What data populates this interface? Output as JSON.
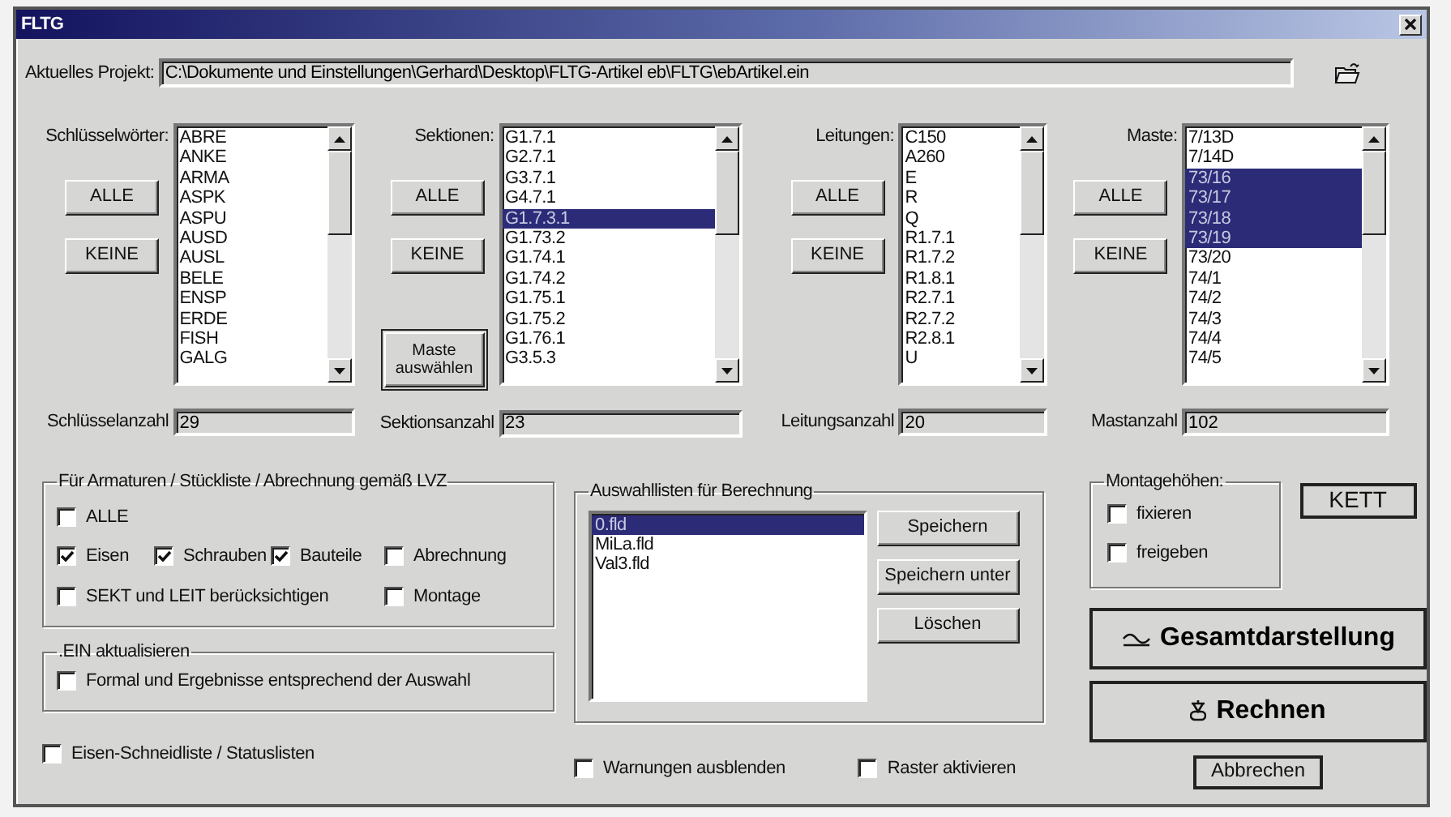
{
  "window": {
    "title": "FLTG"
  },
  "project": {
    "label": "Aktuelles Projekt:",
    "value": "C:\\Dokumente und Einstellungen\\Gerhard\\Desktop\\FLTG-Artikel eb\\FLTG\\ebArtikel.ein"
  },
  "lists": [
    {
      "label": "Schlüsselwörter:",
      "buttons": [
        "ALLE",
        "KEINE"
      ],
      "count_label": "Schlüsselanzahl",
      "count": "29",
      "items": [
        {
          "text": "ABRE",
          "selected": false
        },
        {
          "text": "ANKE",
          "selected": false
        },
        {
          "text": "ARMA",
          "selected": false
        },
        {
          "text": "ASPK",
          "selected": false
        },
        {
          "text": "ASPU",
          "selected": false
        },
        {
          "text": "AUSD",
          "selected": false
        },
        {
          "text": "AUSL",
          "selected": false
        },
        {
          "text": "BELE",
          "selected": false
        },
        {
          "text": "ENSP",
          "selected": false
        },
        {
          "text": "ERDE",
          "selected": false
        },
        {
          "text": "FISH",
          "selected": false
        },
        {
          "text": "GALG",
          "selected": false
        }
      ]
    },
    {
      "label": "Sektionen:",
      "buttons": [
        "ALLE",
        "KEINE"
      ],
      "extra_button": "Maste auswählen",
      "count_label": "Sektionsanzahl",
      "count": "23",
      "items": [
        {
          "text": "G1.7.1",
          "selected": false
        },
        {
          "text": "G2.7.1",
          "selected": false
        },
        {
          "text": "G3.7.1",
          "selected": false
        },
        {
          "text": "G4.7.1",
          "selected": false
        },
        {
          "text": "G1.7.3.1",
          "selected": true
        },
        {
          "text": "G1.73.2",
          "selected": false
        },
        {
          "text": "G1.74.1",
          "selected": false
        },
        {
          "text": "G1.74.2",
          "selected": false
        },
        {
          "text": "G1.75.1",
          "selected": false
        },
        {
          "text": "G1.75.2",
          "selected": false
        },
        {
          "text": "G1.76.1",
          "selected": false
        },
        {
          "text": "G3.5.3",
          "selected": false
        }
      ]
    },
    {
      "label": "Leitungen:",
      "buttons": [
        "ALLE",
        "KEINE"
      ],
      "count_label": "Leitungsanzahl",
      "count": "20",
      "items": [
        {
          "text": "C150",
          "selected": false
        },
        {
          "text": "A260",
          "selected": false
        },
        {
          "text": "E",
          "selected": false
        },
        {
          "text": "R",
          "selected": false
        },
        {
          "text": "Q",
          "selected": false
        },
        {
          "text": "R1.7.1",
          "selected": false
        },
        {
          "text": "R1.7.2",
          "selected": false
        },
        {
          "text": "R1.8.1",
          "selected": false
        },
        {
          "text": "R2.7.1",
          "selected": false
        },
        {
          "text": "R2.7.2",
          "selected": false
        },
        {
          "text": "R2.8.1",
          "selected": false
        },
        {
          "text": "U",
          "selected": false
        }
      ]
    },
    {
      "label": "Maste:",
      "buttons": [
        "ALLE",
        "KEINE"
      ],
      "count_label": "Mastanzahl",
      "count": "102",
      "items": [
        {
          "text": "7/13D",
          "selected": false
        },
        {
          "text": "7/14D",
          "selected": false
        },
        {
          "text": "73/16",
          "selected": true
        },
        {
          "text": "73/17",
          "selected": true
        },
        {
          "text": "73/18",
          "selected": true
        },
        {
          "text": "73/19",
          "selected": true
        },
        {
          "text": "73/20",
          "selected": false
        },
        {
          "text": "74/1",
          "selected": false
        },
        {
          "text": "74/2",
          "selected": false
        },
        {
          "text": "74/3",
          "selected": false
        },
        {
          "text": "74/4",
          "selected": false
        },
        {
          "text": "74/5",
          "selected": false
        }
      ]
    }
  ],
  "armaturen": {
    "title": "Für Armaturen / Stückliste / Abrechnung gemäß LVZ",
    "rows": [
      [
        {
          "label": "ALLE",
          "checked": false
        }
      ],
      [
        {
          "label": "Eisen",
          "checked": true
        },
        {
          "label": "Schrauben",
          "checked": true
        },
        {
          "label": "Bauteile",
          "checked": true
        },
        {
          "label": "Abrechnung",
          "checked": false
        }
      ],
      [
        {
          "label": "SEKT und LEIT  berücksichtigen",
          "checked": false
        },
        "",
        "",
        {
          "label": "Montage",
          "checked": false
        }
      ]
    ]
  },
  "ein": {
    "title": ".EIN aktualisieren",
    "checkbox": {
      "label": "Formal und Ergebnisse entsprechend der Auswahl",
      "checked": false
    }
  },
  "auswahl": {
    "title": "Auswahllisten für Berechnung",
    "items": [
      {
        "text": "0.fld",
        "selected": true
      },
      {
        "text": "MiLa.fld",
        "selected": false
      },
      {
        "text": "Val3.fld",
        "selected": false
      }
    ],
    "buttons": [
      "Speichern",
      "Speichern unter",
      "Löschen"
    ]
  },
  "montage": {
    "title": "Montagehöhen:",
    "checkboxes": [
      {
        "label": "fixieren",
        "checked": false
      },
      {
        "label": "freigeben",
        "checked": false
      }
    ]
  },
  "kett": "KETT",
  "gesamt": "Gesamtdarstellung",
  "rechnen": "Rechnen",
  "abbrechen": "Abbrechen",
  "bottom_checkboxes": [
    {
      "label": "Eisen-Schneidliste / Statuslisten",
      "checked": false
    },
    {
      "label": "Warnungen ausblenden",
      "checked": false
    },
    {
      "label": "Raster aktivieren",
      "checked": false
    }
  ]
}
